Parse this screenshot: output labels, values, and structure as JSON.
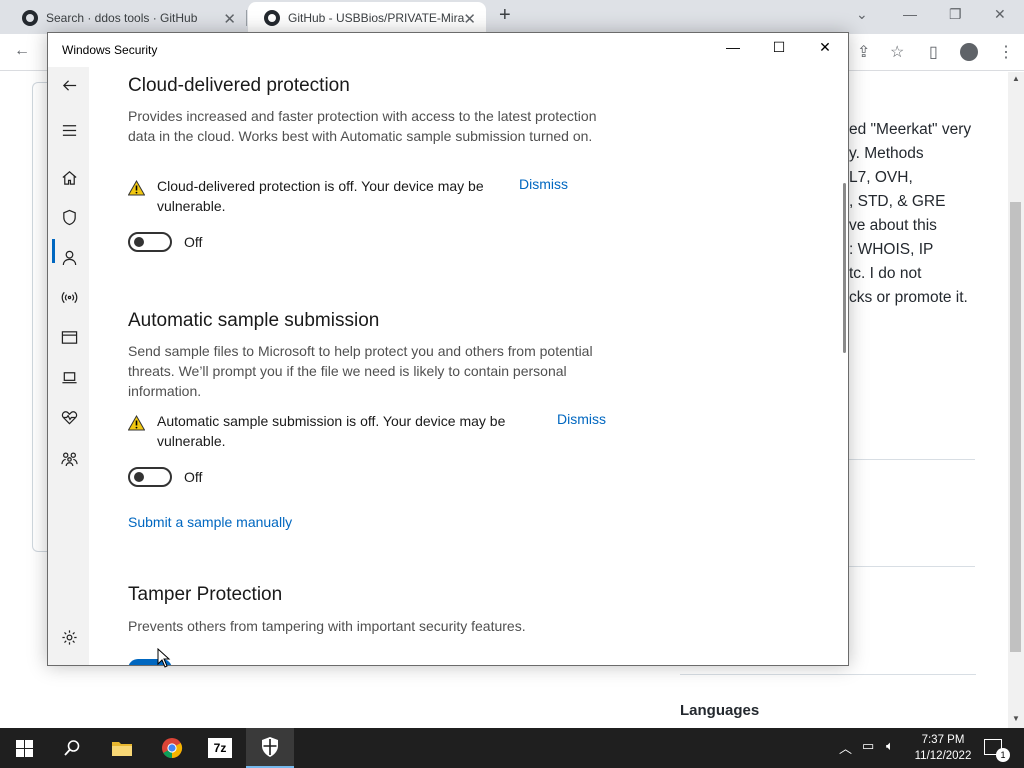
{
  "browser": {
    "tabs": [
      {
        "title": "Search · ddos tools · GitHub"
      },
      {
        "title": "GitHub - USBBios/PRIVATE-Mira"
      }
    ],
    "new_tab_symbol": "+",
    "background_text_lines": [
      "ed \"Meerkat\" very",
      "y. Methods",
      "L7, OVH,",
      ", STD, & GRE",
      "ve about this",
      ": WHOIS, IP",
      "tc. I do not",
      "cks or promote it."
    ],
    "languages_heading": "Languages"
  },
  "window": {
    "title": "Windows Security",
    "controls": {
      "minimize": "—",
      "maximize": "☐",
      "close": "✕"
    }
  },
  "sidebar": {
    "items": [
      {
        "icon": "back-arrow-icon"
      },
      {
        "icon": "hamburger-menu-icon"
      },
      {
        "icon": "home-icon"
      },
      {
        "icon": "shield-icon",
        "active": true
      },
      {
        "icon": "account-person-icon"
      },
      {
        "icon": "wireless-network-icon"
      },
      {
        "icon": "app-browser-window-icon"
      },
      {
        "icon": "laptop-device-icon"
      },
      {
        "icon": "heart-health-icon"
      },
      {
        "icon": "family-options-icon"
      },
      {
        "icon": "settings-gear-icon"
      }
    ],
    "active_color": "#0067c0"
  },
  "cloud": {
    "heading": "Cloud-delivered protection",
    "description": "Provides increased and faster protection with access to the latest protection data in the cloud. Works best with Automatic sample submission turned on.",
    "warning": "Cloud-delivered protection is off. Your device may be vulnerable.",
    "dismiss": "Dismiss",
    "toggle_state": "Off"
  },
  "sample": {
    "heading": "Automatic sample submission",
    "description": "Send sample files to Microsoft to help protect you and others from potential threats. We’ll prompt you if the file we need is likely to contain personal information.",
    "warning": "Automatic sample submission is off. Your device may be vulnerable.",
    "dismiss": "Dismiss",
    "toggle_state": "Off",
    "manual_link": "Submit a sample manually"
  },
  "tamper": {
    "heading": "Tamper Protection",
    "description": "Prevents others from tampering with important security features."
  },
  "taskbar": {
    "apps": [
      "start-icon",
      "search-icon",
      "file-explorer-icon",
      "chrome-icon",
      "7zip-icon",
      "windows-security-icon"
    ],
    "seven_zip_label": "7z",
    "time": "7:37 PM",
    "date": "11/12/2022",
    "notification_count": "1"
  },
  "colors": {
    "accent": "#0067c0",
    "warning": "#f2c811",
    "taskbar": "#1f1f1f"
  }
}
